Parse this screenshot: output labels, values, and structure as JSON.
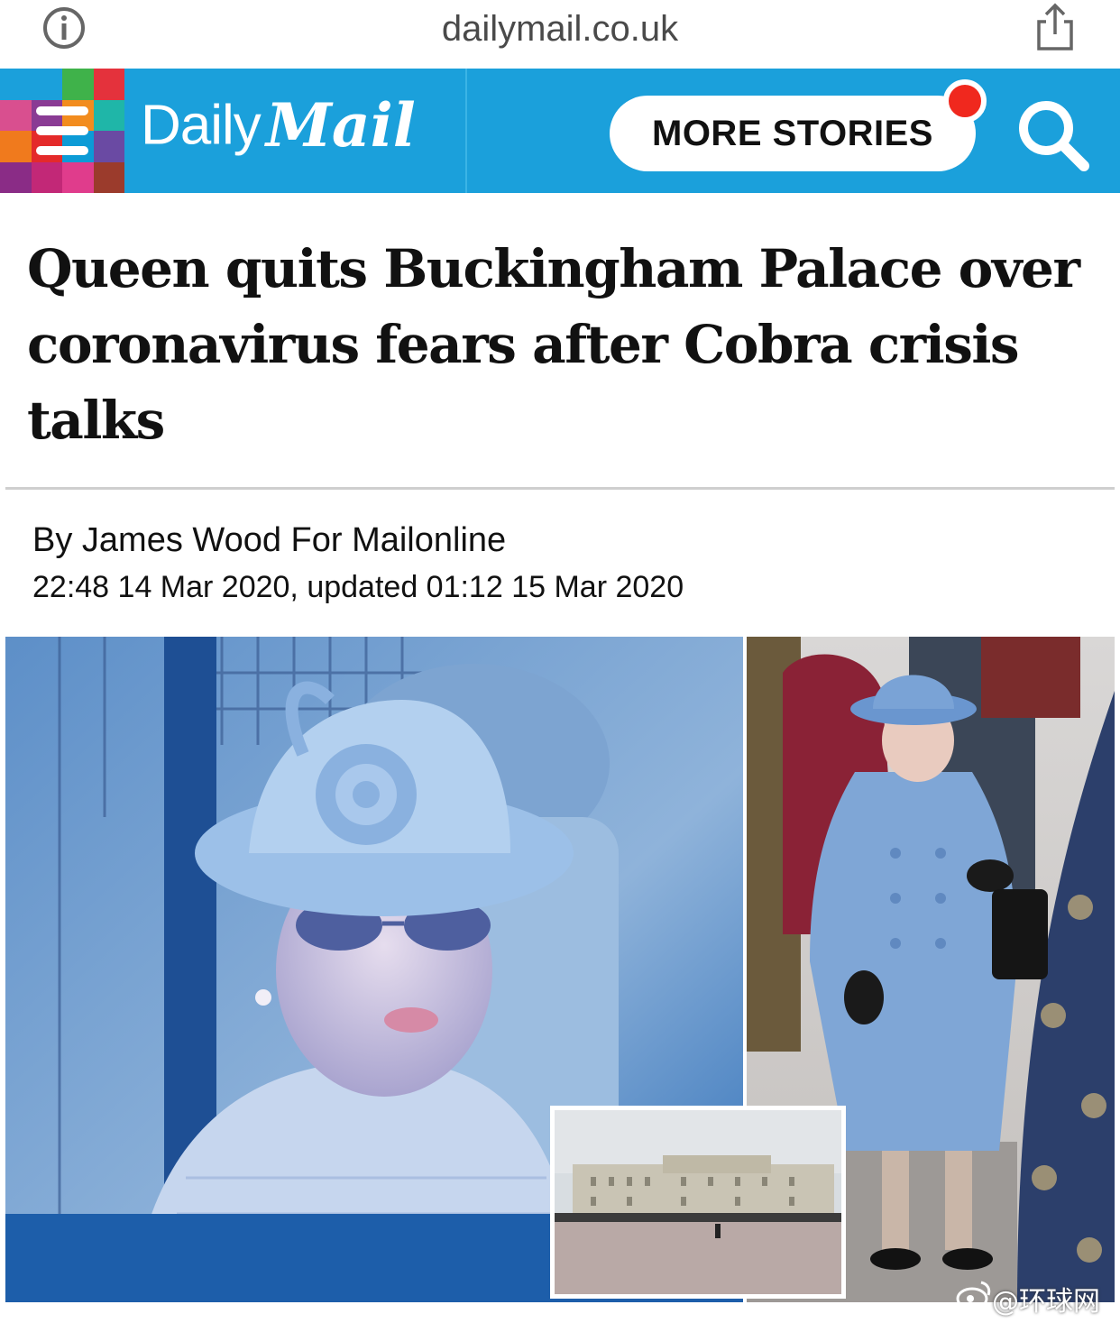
{
  "browser": {
    "url": "dailymail.co.uk",
    "info_icon": "info-icon",
    "share_icon": "share-icon"
  },
  "header": {
    "logo_daily": "Daily",
    "logo_mail": "Mail",
    "more_stories_label": "MORE STORIES",
    "menu_icon": "hamburger-menu-icon",
    "search_icon": "search-icon",
    "brand_color": "#1ba0db",
    "notification_color": "#f0281e"
  },
  "article": {
    "headline": "Queen quits Buckingham Palace over coronavirus fears after Cobra crisis talks",
    "byline": "By James Wood For Mailonline",
    "dateline": "22:48 14 Mar 2020, updated 01:12 15 Mar 2020"
  },
  "watermark": {
    "text": "@环球网"
  }
}
